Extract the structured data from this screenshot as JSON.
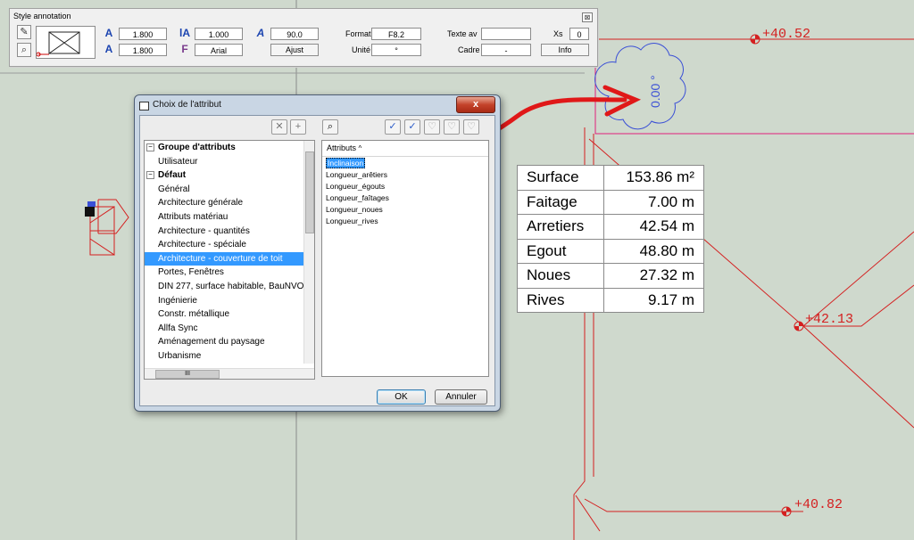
{
  "style_bar": {
    "title": "Style annotation",
    "close": "⊠",
    "text_height": "1.800",
    "text_width": "1.800",
    "ratio": "1.000",
    "font": "Arial",
    "angle": "90.0",
    "ajust": "Ajust",
    "format_label": "Format",
    "format_value": "F8.2",
    "unite_label": "Unité",
    "unite_value": "°",
    "texte_av_label": "Texte av",
    "texte_av_value": "",
    "cadre_label": "Cadre",
    "cadre_value": "-",
    "xs_label": "Xs",
    "xs_value": "0",
    "info": "Info",
    "icons": [
      "pencil-icon",
      "pick-icon",
      "text-height-icon",
      "text-width-icon",
      "ratio-icon",
      "font-icon",
      "angle-icon"
    ]
  },
  "dialog": {
    "title": "Choix de l'attribut",
    "close": "x",
    "groups": [
      {
        "label": "Groupe d'attributs",
        "header": true,
        "expander": "−"
      },
      {
        "label": "Utilisateur"
      },
      {
        "label": "Défaut",
        "header": true,
        "expander": "−"
      },
      {
        "label": "Général"
      },
      {
        "label": "Architecture générale"
      },
      {
        "label": "Attributs matériau"
      },
      {
        "label": "Architecture - quantités"
      },
      {
        "label": "Architecture - spéciale"
      },
      {
        "label": "Architecture - couverture de toit",
        "selected": true
      },
      {
        "label": "Portes, Fenêtres"
      },
      {
        "label": "DIN 277, surface habitable, BauNVO"
      },
      {
        "label": "Ingénierie"
      },
      {
        "label": "Constr. métallique"
      },
      {
        "label": "Allfa Sync"
      },
      {
        "label": "Aménagement du paysage"
      },
      {
        "label": "Urbanisme"
      }
    ],
    "attr_header": "Attributs",
    "attributes": [
      {
        "label": "Inclinaison",
        "selected": true
      },
      {
        "label": "Longueur_arêtiers"
      },
      {
        "label": "Longueur_égouts"
      },
      {
        "label": "Longueur_faîtages"
      },
      {
        "label": "Longueur_noues"
      },
      {
        "label": "Longueur_rives"
      }
    ],
    "hscroll_grip": "III",
    "ok": "OK",
    "cancel": "Annuler"
  },
  "quantities": [
    {
      "label": "Surface",
      "value": "153.86 m²"
    },
    {
      "label": "Faitage",
      "value": "7.00 m"
    },
    {
      "label": "Arretiers",
      "value": "42.54 m"
    },
    {
      "label": "Egout",
      "value": "48.80 m"
    },
    {
      "label": "Noues",
      "value": "27.32 m"
    },
    {
      "label": "Rives",
      "value": "9.17 m"
    }
  ],
  "elevations": [
    "+40.52",
    "+42.13",
    "+40.82"
  ],
  "cloud_label": "0.00 °",
  "colors": {
    "background": "#cfd9cd",
    "cad_red": "#d42020",
    "magenta": "#e0207a",
    "cloud_blue": "#3a4fd6",
    "arrow_red": "#e01818",
    "selection": "#3399ff"
  }
}
